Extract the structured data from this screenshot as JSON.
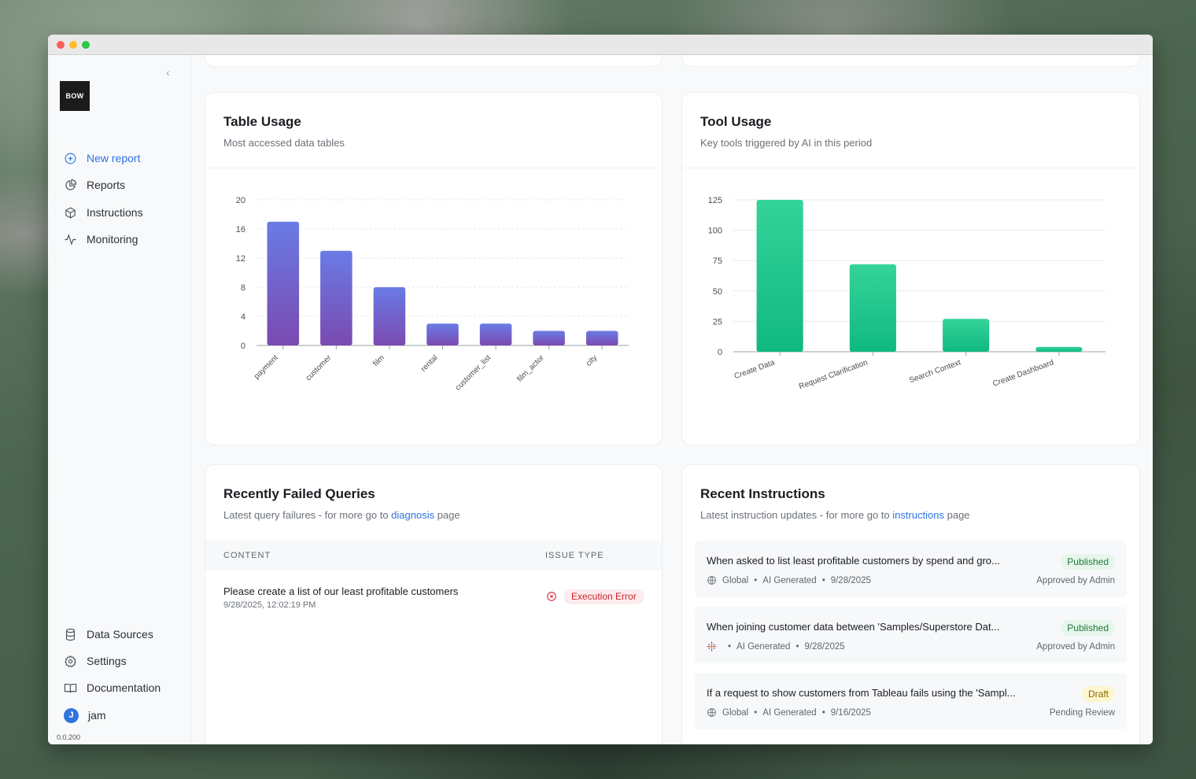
{
  "sidebar": {
    "logo": "BOW",
    "nav": [
      {
        "label": "New report",
        "icon": "plus-circle-icon",
        "active": true
      },
      {
        "label": "Reports",
        "icon": "pie-chart-icon"
      },
      {
        "label": "Instructions",
        "icon": "cube-icon"
      },
      {
        "label": "Monitoring",
        "icon": "activity-icon"
      }
    ],
    "bottom_nav": [
      {
        "label": "Data Sources",
        "icon": "database-icon"
      },
      {
        "label": "Settings",
        "icon": "gear-icon"
      },
      {
        "label": "Documentation",
        "icon": "book-icon"
      }
    ],
    "user": {
      "initial": "J",
      "name": "jam"
    },
    "version": "0.0.200"
  },
  "table_usage": {
    "title": "Table Usage",
    "subtitle": "Most accessed data tables"
  },
  "tool_usage": {
    "title": "Tool Usage",
    "subtitle": "Key tools triggered by AI in this period"
  },
  "chart_data": [
    {
      "type": "bar",
      "categories": [
        "payment",
        "customer",
        "film",
        "rental",
        "customer_list",
        "film_actor",
        "city"
      ],
      "values": [
        17,
        13,
        8,
        3,
        3,
        2,
        2
      ],
      "yticks": [
        0,
        4,
        8,
        12,
        16,
        20
      ],
      "ylim": [
        0,
        20
      ],
      "grid": true,
      "colors": {
        "top": "#6a7be6",
        "bottom": "#7a4ab0"
      }
    },
    {
      "type": "bar",
      "categories": [
        "Create Data",
        "Request Clarification",
        "Search Context",
        "Create Dashboard"
      ],
      "values": [
        125,
        72,
        27,
        4
      ],
      "yticks": [
        0,
        25,
        50,
        75,
        100,
        125
      ],
      "ylim": [
        0,
        125
      ],
      "grid": true,
      "colors": {
        "top": "#34d399",
        "bottom": "#10b981"
      }
    }
  ],
  "failed_queries": {
    "title": "Recently Failed Queries",
    "subtitle_prefix": "Latest query failures - for more go to ",
    "subtitle_link": "diagnosis",
    "subtitle_suffix": " page",
    "columns": [
      "CONTENT",
      "ISSUE TYPE"
    ],
    "rows": [
      {
        "content": "Please create a list of our least profitable customers",
        "date": "9/28/2025, 12:02:19 PM",
        "issue": "Execution Error"
      }
    ]
  },
  "recent_instructions": {
    "title": "Recent Instructions",
    "subtitle_prefix": "Latest instruction updates - for more go to ",
    "subtitle_link": "instructions",
    "subtitle_suffix": " page",
    "items": [
      {
        "text": "When asked to list least profitable customers by spend and gro...",
        "scope": "Global",
        "source": "AI Generated",
        "date": "9/28/2025",
        "status": "Published",
        "approval": "Approved by Admin",
        "scope_icon": "globe-icon"
      },
      {
        "text": "When joining customer data between 'Samples/Superstore Dat...",
        "scope": "",
        "source": "AI Generated",
        "date": "9/28/2025",
        "status": "Published",
        "approval": "Approved by Admin",
        "scope_icon": "tableau-icon"
      },
      {
        "text": "If a request to show customers from Tableau fails using the 'Sampl...",
        "scope": "Global",
        "source": "AI Generated",
        "date": "9/16/2025",
        "status": "Draft",
        "approval": "Pending Review",
        "scope_icon": "globe-icon"
      }
    ]
  },
  "colors": {
    "accent": "#2f74e0",
    "error": "#c9252d"
  }
}
